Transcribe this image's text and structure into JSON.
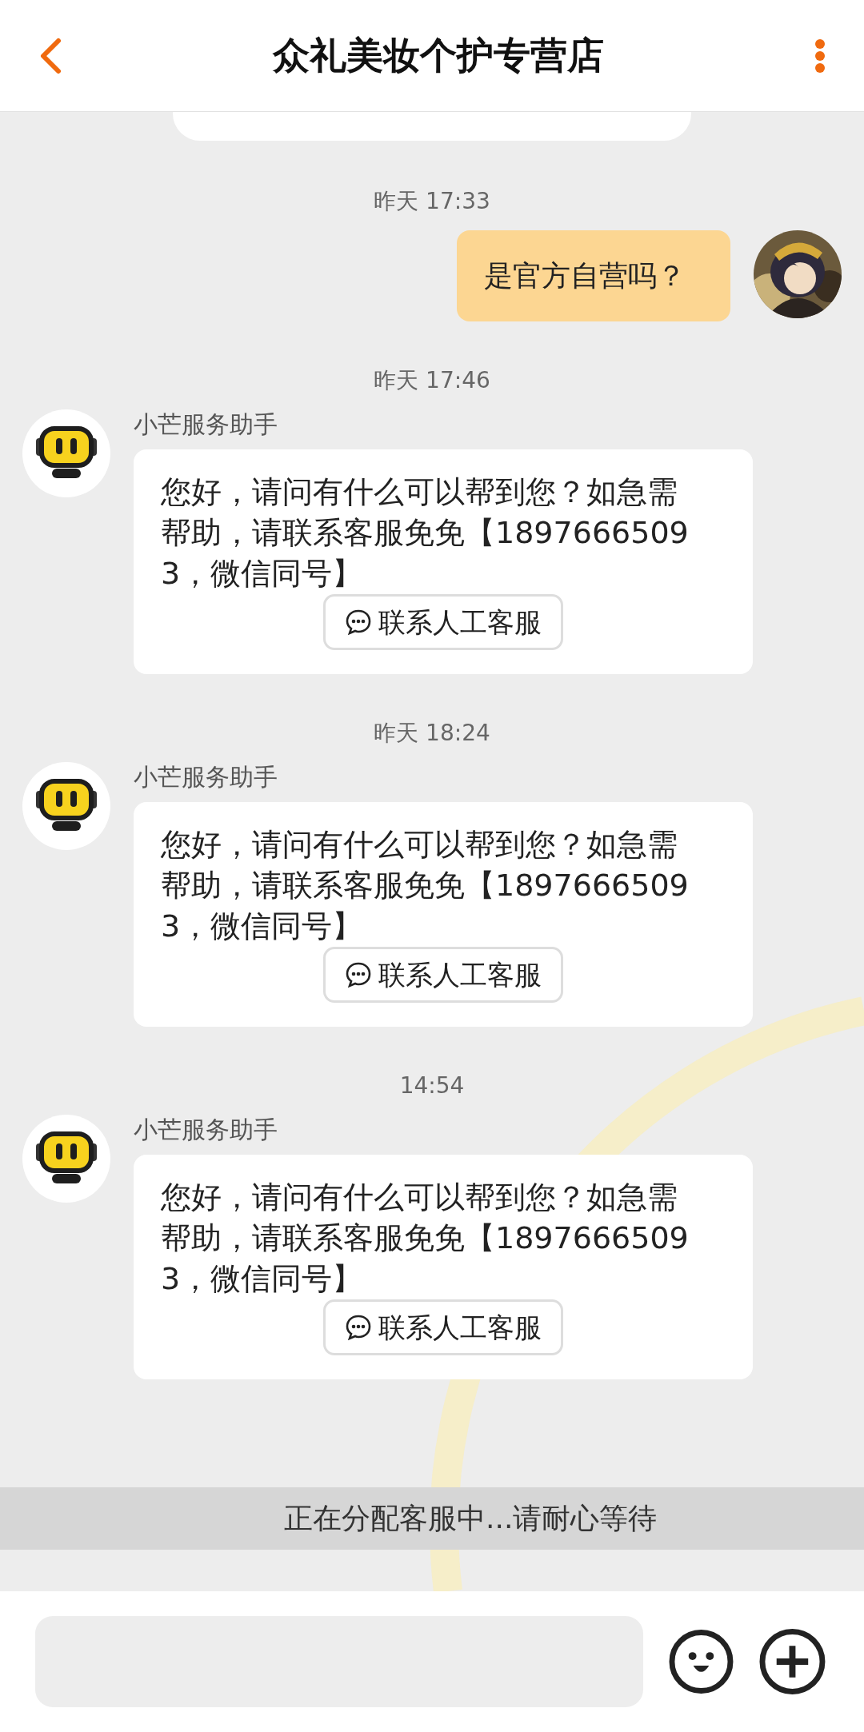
{
  "header": {
    "title": "众礼美妆个护专营店"
  },
  "messages": [
    {
      "kind": "partial"
    },
    {
      "kind": "time",
      "text": "昨天 17:33"
    },
    {
      "kind": "outgoing",
      "text": "是官方自营吗？"
    },
    {
      "kind": "time",
      "text": "昨天 17:46"
    },
    {
      "kind": "bot",
      "sender": "小芒服务助手",
      "text": "您好，请问有什么可以帮到您？如急需帮助，请联系客服免免【18976665093，微信同号】",
      "button": "联系人工客服"
    },
    {
      "kind": "time",
      "text": "昨天 18:24"
    },
    {
      "kind": "bot",
      "sender": "小芒服务助手",
      "text": "您好，请问有什么可以帮到您？如急需帮助，请联系客服免免【18976665093，微信同号】",
      "button": "联系人工客服"
    },
    {
      "kind": "time",
      "text": "14:54"
    },
    {
      "kind": "bot",
      "sender": "小芒服务助手",
      "text": "您好，请问有什么可以帮到您？如急需帮助，请联系客服免免【18976665093，微信同号】",
      "button": "联系人工客服"
    }
  ],
  "status_banner": {
    "text": "正在分配客服中...请耐心等待"
  }
}
